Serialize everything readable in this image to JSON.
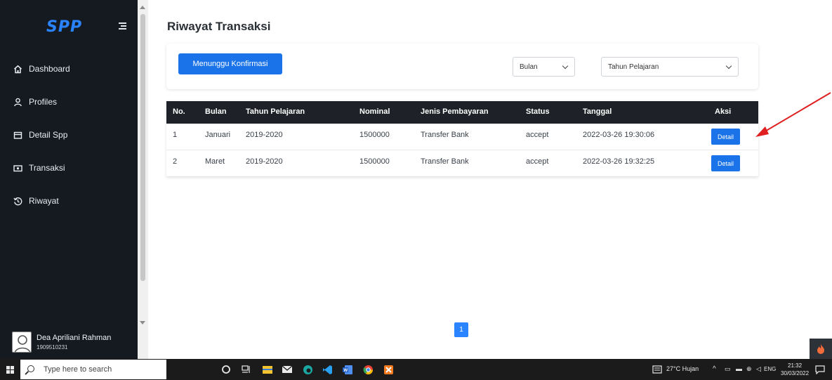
{
  "app": {
    "logo": "SPP",
    "colors": {
      "sidebar": "#151a21",
      "primary": "#1a73e8",
      "table_header": "#1e2228",
      "arrow": "#e02020"
    }
  },
  "sidebar": {
    "items": [
      {
        "label": "Dashboard",
        "icon": "home-icon"
      },
      {
        "label": "Profiles",
        "icon": "user-icon"
      },
      {
        "label": "Detail Spp",
        "icon": "wallet-icon"
      },
      {
        "label": "Transaksi",
        "icon": "money-icon"
      },
      {
        "label": "Riwayat",
        "icon": "history-icon"
      }
    ],
    "user": {
      "name": "Dea Apriliani Rahman",
      "id": "1909510231"
    }
  },
  "main": {
    "title": "Riwayat Transaksi",
    "filter": {
      "button": "Menunggu Konfirmasi",
      "month_select": "Bulan",
      "year_select": "Tahun Pelajaran"
    },
    "table": {
      "headers": [
        "No.",
        "Bulan",
        "Tahun Pelajaran",
        "Nominal",
        "Jenis Pembayaran",
        "Status",
        "Tanggal",
        "Aksi"
      ],
      "rows": [
        [
          "1",
          "Januari",
          "2019-2020",
          "1500000",
          "Transfer Bank",
          "accept",
          "2022-03-26 19:30:06",
          "Detail"
        ],
        [
          "2",
          "Maret",
          "2019-2020",
          "1500000",
          "Transfer Bank",
          "accept",
          "2022-03-26 19:32:25",
          "Detail"
        ]
      ]
    },
    "pagination": {
      "current": "1"
    }
  },
  "taskbar": {
    "search_placeholder": "Type here to search",
    "weather": "27°C Hujan",
    "language": "ENG",
    "time": "21:32",
    "date": "30/03/2022"
  }
}
